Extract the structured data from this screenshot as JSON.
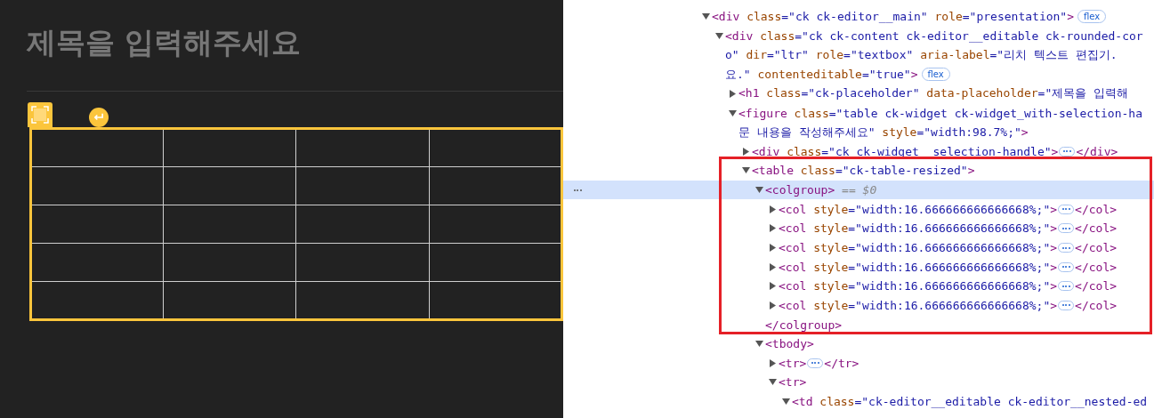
{
  "editor": {
    "title": {
      "placeholder": "제목을 입력해주세요"
    },
    "table": {
      "selected": true,
      "rows": [
        {
          "cells": [
            {
              "kind": "empty"
            },
            {
              "kind": "empty"
            },
            {
              "kind": "empty"
            },
            {
              "kind": "empty"
            }
          ]
        },
        {
          "cells": [
            {
              "kind": "empty"
            },
            {
              "kind": "empty"
            },
            {
              "kind": "empty"
            },
            {
              "kind": "empty"
            }
          ]
        },
        {
          "cells": [
            {
              "kind": "empty"
            },
            {
              "kind": "empty"
            },
            {
              "kind": "empty"
            },
            {
              "kind": "empty"
            }
          ]
        },
        {
          "cells": [
            {
              "kind": "empty"
            },
            {
              "kind": "empty"
            },
            {
              "kind": "empty"
            },
            {
              "kind": "empty"
            }
          ]
        },
        {
          "cells": [
            {
              "kind": "empty"
            },
            {
              "kind": "empty"
            },
            {
              "kind": "empty"
            },
            {
              "kind": "empty"
            }
          ]
        }
      ]
    }
  },
  "devtools": {
    "nodes": [
      {
        "expanded": true,
        "selected": false,
        "rows": [
          {
            "parts": [
              {
                "kind": "code",
                "segments": [
                  {
                    "kind": "tag",
                    "text": "<div"
                  },
                  {
                    "kind": "attr",
                    "text": " class"
                  },
                  {
                    "kind": "value",
                    "text": "=\"ck ck-editor__main\""
                  },
                  {
                    "kind": "attr",
                    "text": " role"
                  },
                  {
                    "kind": "value",
                    "text": "=\"presentation\""
                  },
                  {
                    "kind": "tag",
                    "text": ">"
                  }
                ]
              },
              {
                "kind": "badge",
                "text": "flex"
              }
            ]
          }
        ],
        "children": [
          {
            "expanded": true,
            "selected": false,
            "rows": [
              {
                "parts": [
                  {
                    "kind": "code",
                    "segments": [
                      {
                        "kind": "tag",
                        "text": "<div"
                      },
                      {
                        "kind": "attr",
                        "text": " class"
                      },
                      {
                        "kind": "value",
                        "text": "=\"ck ck-content ck-editor__editable ck-rounded-cor"
                      }
                    ]
                  }
                ]
              },
              {
                "parts": [
                  {
                    "kind": "code",
                    "segments": [
                      {
                        "kind": "value",
                        "text": "o\""
                      },
                      {
                        "kind": "attr",
                        "text": " dir"
                      },
                      {
                        "kind": "value",
                        "text": "=\"ltr\""
                      },
                      {
                        "kind": "attr",
                        "text": " role"
                      },
                      {
                        "kind": "value",
                        "text": "=\"textbox\""
                      },
                      {
                        "kind": "attr",
                        "text": " aria-label"
                      },
                      {
                        "kind": "value",
                        "text": "=\"리치 텍스트 편집기."
                      }
                    ]
                  }
                ]
              },
              {
                "parts": [
                  {
                    "kind": "code",
                    "segments": [
                      {
                        "kind": "value",
                        "text": "요.\""
                      },
                      {
                        "kind": "attr",
                        "text": " contenteditable"
                      },
                      {
                        "kind": "value",
                        "text": "=\"true\""
                      },
                      {
                        "kind": "tag",
                        "text": ">"
                      }
                    ]
                  },
                  {
                    "kind": "badge",
                    "text": "flex"
                  }
                ]
              }
            ],
            "children": [
              {
                "expanded": false,
                "selected": false,
                "rows": [
                  {
                    "parts": [
                      {
                        "kind": "code",
                        "segments": [
                          {
                            "kind": "tag",
                            "text": "<h1"
                          },
                          {
                            "kind": "attr",
                            "text": " class"
                          },
                          {
                            "kind": "value",
                            "text": "=\"ck-placeholder\""
                          },
                          {
                            "kind": "attr",
                            "text": " data-placeholder"
                          },
                          {
                            "kind": "value",
                            "text": "=\"제목을 입력해"
                          }
                        ]
                      }
                    ]
                  }
                ]
              },
              {
                "expanded": true,
                "selected": false,
                "rows": [
                  {
                    "parts": [
                      {
                        "kind": "code",
                        "segments": [
                          {
                            "kind": "tag",
                            "text": "<figure"
                          },
                          {
                            "kind": "attr",
                            "text": " class"
                          },
                          {
                            "kind": "value",
                            "text": "=\"table ck-widget ck-widget_with-selection-ha"
                          }
                        ]
                      }
                    ]
                  },
                  {
                    "parts": [
                      {
                        "kind": "code",
                        "segments": [
                          {
                            "kind": "value",
                            "text": "문 내용을 작성해주세요\""
                          },
                          {
                            "kind": "attr",
                            "text": " style"
                          },
                          {
                            "kind": "value",
                            "text": "=\"width:98.7%;\""
                          },
                          {
                            "kind": "tag",
                            "text": ">"
                          }
                        ]
                      }
                    ]
                  }
                ],
                "children": [
                  {
                    "expanded": false,
                    "selected": false,
                    "rows": [
                      {
                        "parts": [
                          {
                            "kind": "code",
                            "segments": [
                              {
                                "kind": "tag",
                                "text": "<div"
                              },
                              {
                                "kind": "attr",
                                "text": " class"
                              },
                              {
                                "kind": "value",
                                "text": "=\"ck ck-widget__selection-handle\""
                              },
                              {
                                "kind": "tag",
                                "text": ">"
                              }
                            ]
                          },
                          {
                            "kind": "ellipsis"
                          },
                          {
                            "kind": "code",
                            "segments": [
                              {
                                "kind": "tag",
                                "text": "</div>"
                              }
                            ]
                          }
                        ]
                      }
                    ]
                  },
                  {
                    "expanded": true,
                    "selected": false,
                    "rows": [
                      {
                        "parts": [
                          {
                            "kind": "code",
                            "segments": [
                              {
                                "kind": "tag",
                                "text": "<table"
                              },
                              {
                                "kind": "attr",
                                "text": " class"
                              },
                              {
                                "kind": "value",
                                "text": "=\"ck-table-resized\""
                              },
                              {
                                "kind": "tag",
                                "text": ">"
                              }
                            ]
                          }
                        ]
                      }
                    ],
                    "children": [
                      {
                        "expanded": true,
                        "selected": true,
                        "rows": [
                          {
                            "parts": [
                              {
                                "kind": "code",
                                "segments": [
                                  {
                                    "kind": "tag",
                                    "text": "<colgroup>"
                                  },
                                  {
                                    "kind": "comment",
                                    "text": " == $0"
                                  }
                                ]
                              }
                            ]
                          }
                        ],
                        "children": [
                          {
                            "expanded": false,
                            "selected": false,
                            "rows": [
                              {
                                "parts": [
                                  {
                                    "kind": "code",
                                    "segments": [
                                      {
                                        "kind": "tag",
                                        "text": "<col"
                                      },
                                      {
                                        "kind": "attr",
                                        "text": " style"
                                      },
                                      {
                                        "kind": "value",
                                        "text": "=\"width:16.666666666666668%;\""
                                      },
                                      {
                                        "kind": "tag",
                                        "text": ">"
                                      }
                                    ]
                                  },
                                  {
                                    "kind": "ellipsis"
                                  },
                                  {
                                    "kind": "code",
                                    "segments": [
                                      {
                                        "kind": "tag",
                                        "text": "</col>"
                                      }
                                    ]
                                  }
                                ]
                              }
                            ]
                          },
                          {
                            "expanded": false,
                            "selected": false,
                            "rows": [
                              {
                                "parts": [
                                  {
                                    "kind": "code",
                                    "segments": [
                                      {
                                        "kind": "tag",
                                        "text": "<col"
                                      },
                                      {
                                        "kind": "attr",
                                        "text": " style"
                                      },
                                      {
                                        "kind": "value",
                                        "text": "=\"width:16.666666666666668%;\""
                                      },
                                      {
                                        "kind": "tag",
                                        "text": ">"
                                      }
                                    ]
                                  },
                                  {
                                    "kind": "ellipsis"
                                  },
                                  {
                                    "kind": "code",
                                    "segments": [
                                      {
                                        "kind": "tag",
                                        "text": "</col>"
                                      }
                                    ]
                                  }
                                ]
                              }
                            ]
                          },
                          {
                            "expanded": false,
                            "selected": false,
                            "rows": [
                              {
                                "parts": [
                                  {
                                    "kind": "code",
                                    "segments": [
                                      {
                                        "kind": "tag",
                                        "text": "<col"
                                      },
                                      {
                                        "kind": "attr",
                                        "text": " style"
                                      },
                                      {
                                        "kind": "value",
                                        "text": "=\"width:16.666666666666668%;\""
                                      },
                                      {
                                        "kind": "tag",
                                        "text": ">"
                                      }
                                    ]
                                  },
                                  {
                                    "kind": "ellipsis"
                                  },
                                  {
                                    "kind": "code",
                                    "segments": [
                                      {
                                        "kind": "tag",
                                        "text": "</col>"
                                      }
                                    ]
                                  }
                                ]
                              }
                            ]
                          },
                          {
                            "expanded": false,
                            "selected": false,
                            "rows": [
                              {
                                "parts": [
                                  {
                                    "kind": "code",
                                    "segments": [
                                      {
                                        "kind": "tag",
                                        "text": "<col"
                                      },
                                      {
                                        "kind": "attr",
                                        "text": " style"
                                      },
                                      {
                                        "kind": "value",
                                        "text": "=\"width:16.666666666666668%;\""
                                      },
                                      {
                                        "kind": "tag",
                                        "text": ">"
                                      }
                                    ]
                                  },
                                  {
                                    "kind": "ellipsis"
                                  },
                                  {
                                    "kind": "code",
                                    "segments": [
                                      {
                                        "kind": "tag",
                                        "text": "</col>"
                                      }
                                    ]
                                  }
                                ]
                              }
                            ]
                          },
                          {
                            "expanded": false,
                            "selected": false,
                            "rows": [
                              {
                                "parts": [
                                  {
                                    "kind": "code",
                                    "segments": [
                                      {
                                        "kind": "tag",
                                        "text": "<col"
                                      },
                                      {
                                        "kind": "attr",
                                        "text": " style"
                                      },
                                      {
                                        "kind": "value",
                                        "text": "=\"width:16.666666666666668%;\""
                                      },
                                      {
                                        "kind": "tag",
                                        "text": ">"
                                      }
                                    ]
                                  },
                                  {
                                    "kind": "ellipsis"
                                  },
                                  {
                                    "kind": "code",
                                    "segments": [
                                      {
                                        "kind": "tag",
                                        "text": "</col>"
                                      }
                                    ]
                                  }
                                ]
                              }
                            ]
                          },
                          {
                            "expanded": false,
                            "selected": false,
                            "rows": [
                              {
                                "parts": [
                                  {
                                    "kind": "code",
                                    "segments": [
                                      {
                                        "kind": "tag",
                                        "text": "<col"
                                      },
                                      {
                                        "kind": "attr",
                                        "text": " style"
                                      },
                                      {
                                        "kind": "value",
                                        "text": "=\"width:16.666666666666668%;\""
                                      },
                                      {
                                        "kind": "tag",
                                        "text": ">"
                                      }
                                    ]
                                  },
                                  {
                                    "kind": "ellipsis"
                                  },
                                  {
                                    "kind": "code",
                                    "segments": [
                                      {
                                        "kind": "tag",
                                        "text": "</col>"
                                      }
                                    ]
                                  }
                                ]
                              }
                            ]
                          }
                        ]
                      },
                      {
                        "selected": false,
                        "rows": [
                          {
                            "parts": [
                              {
                                "kind": "code",
                                "segments": [
                                  {
                                    "kind": "tag",
                                    "text": "</colgroup>"
                                  }
                                ]
                              }
                            ]
                          }
                        ]
                      },
                      {
                        "expanded": true,
                        "selected": false,
                        "rows": [
                          {
                            "parts": [
                              {
                                "kind": "code",
                                "segments": [
                                  {
                                    "kind": "tag",
                                    "text": "<tbody>"
                                  }
                                ]
                              }
                            ]
                          }
                        ],
                        "children": [
                          {
                            "expanded": false,
                            "selected": false,
                            "rows": [
                              {
                                "parts": [
                                  {
                                    "kind": "code",
                                    "segments": [
                                      {
                                        "kind": "tag",
                                        "text": "<tr>"
                                      }
                                    ]
                                  },
                                  {
                                    "kind": "ellipsis"
                                  },
                                  {
                                    "kind": "code",
                                    "segments": [
                                      {
                                        "kind": "tag",
                                        "text": "</tr>"
                                      }
                                    ]
                                  }
                                ]
                              }
                            ]
                          },
                          {
                            "expanded": true,
                            "selected": false,
                            "rows": [
                              {
                                "parts": [
                                  {
                                    "kind": "code",
                                    "segments": [
                                      {
                                        "kind": "tag",
                                        "text": "<tr>"
                                      }
                                    ]
                                  }
                                ]
                              }
                            ],
                            "children": [
                              {
                                "expanded": true,
                                "selected": false,
                                "rows": [
                                  {
                                    "parts": [
                                      {
                                        "kind": "code",
                                        "segments": [
                                          {
                                            "kind": "tag",
                                            "text": "<td"
                                          },
                                          {
                                            "kind": "attr",
                                            "text": " class"
                                          },
                                          {
                                            "kind": "value",
                                            "text": "=\"ck-editor__editable ck-editor__nested-ed"
                                          }
                                        ]
                                      }
                                    ]
                                  }
                                ]
                              }
                            ]
                          }
                        ]
                      }
                    ]
                  }
                ]
              }
            ]
          }
        ]
      }
    ]
  }
}
